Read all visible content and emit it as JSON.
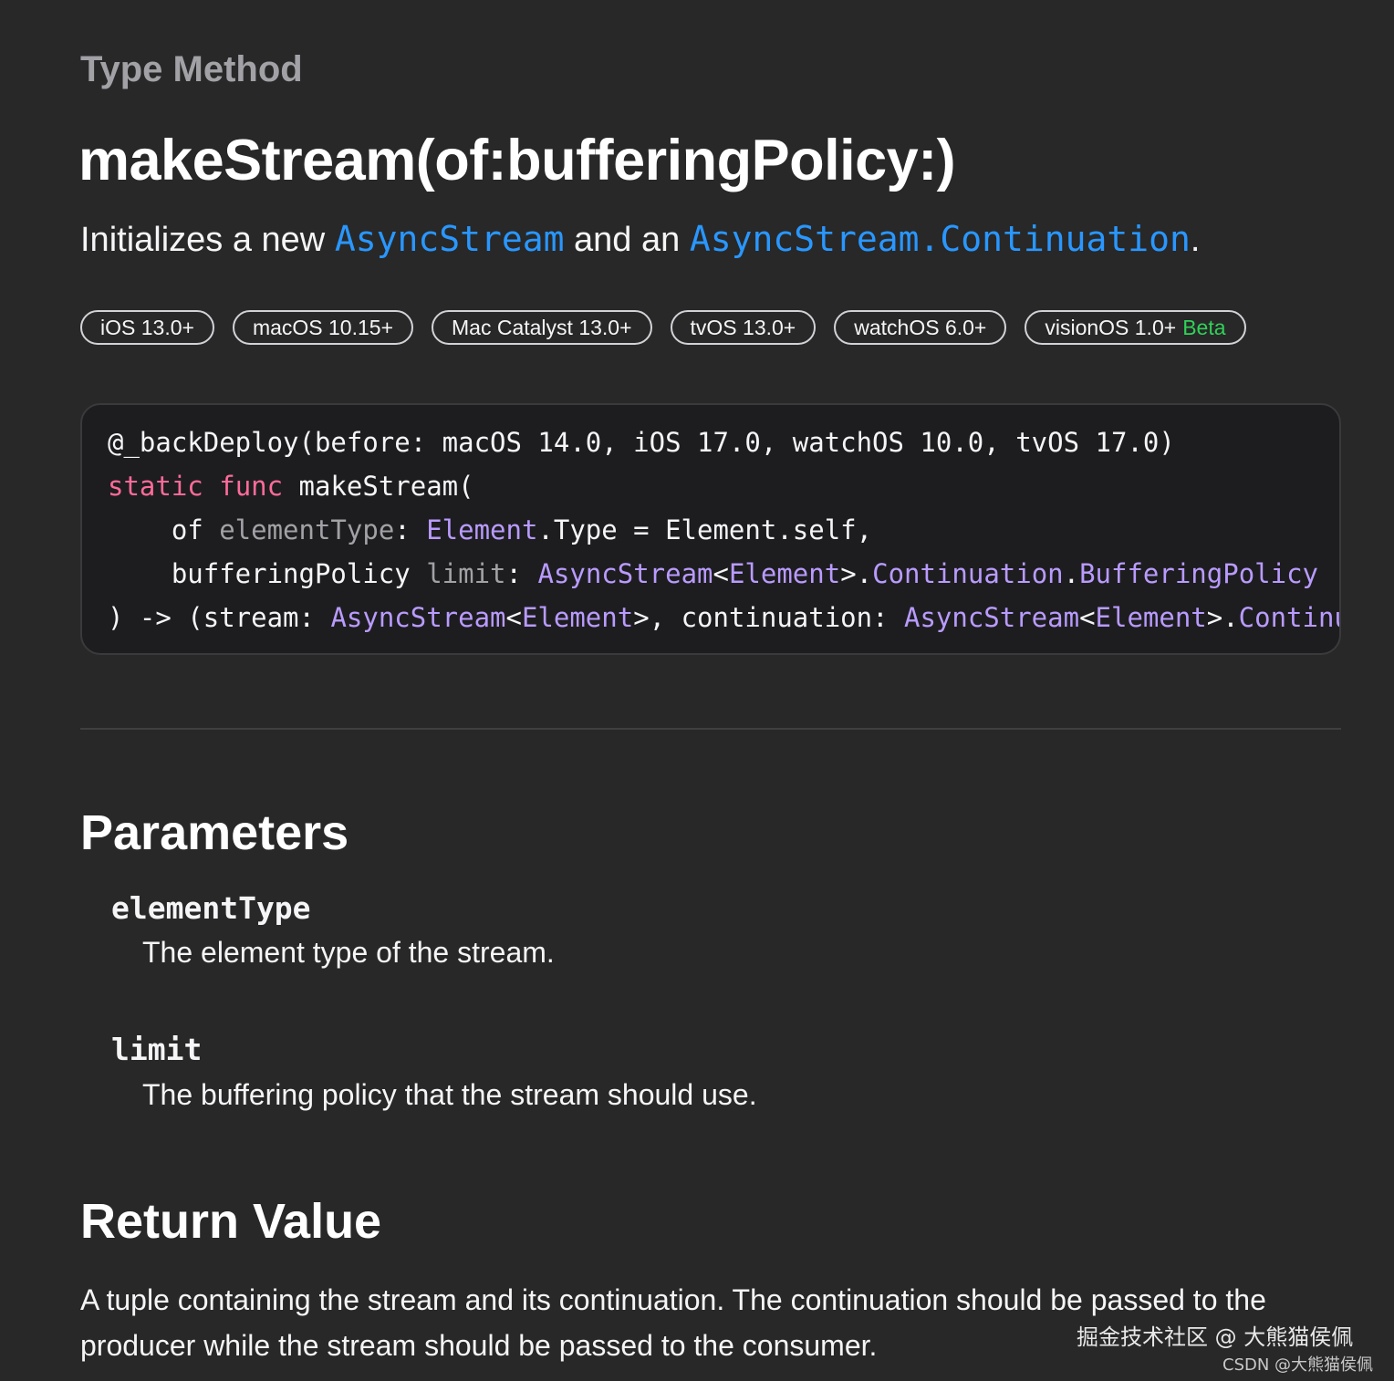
{
  "eyebrow": "Type Method",
  "title": "makeStream(of:bufferingPolicy:)",
  "abstract": {
    "prefix": "Initializes a new ",
    "link1": "AsyncStream",
    "middle": " and an ",
    "link2": "AsyncStream.Continuation",
    "suffix": "."
  },
  "platforms": [
    {
      "label": "iOS 13.0+"
    },
    {
      "label": "macOS 10.15+"
    },
    {
      "label": "Mac Catalyst 13.0+"
    },
    {
      "label": "tvOS 13.0+"
    },
    {
      "label": "watchOS 6.0+"
    },
    {
      "label": "visionOS 1.0+",
      "beta": "Beta"
    }
  ],
  "declaration": {
    "line1": "@_backDeploy(before: macOS 14.0, iOS 17.0, watchOS 10.0, tvOS 17.0)",
    "line2_kw1": "static",
    "line2_kw2": "func",
    "line2_rest": " makeStream(",
    "line3_label": "    of ",
    "line3_param": "elementType",
    "line3_colon": ": ",
    "line3_type": "Element",
    "line3_rest": ".Type = Element.self,",
    "line4_label": "    bufferingPolicy ",
    "line4_param": "limit",
    "line4_colon": ": ",
    "line4_type1": "AsyncStream",
    "line4_lt": "<",
    "line4_type2": "Element",
    "line4_gt": ">.",
    "line4_type3": "Continuation",
    "line4_dot": ".",
    "line4_type4": "BufferingPolicy",
    "line5_start": ") -> (stream: ",
    "line5_type1": "AsyncStream",
    "line5_lt": "<",
    "line5_type2": "Element",
    "line5_mid": ">, continuation: ",
    "line5_type3": "AsyncStream",
    "line5_lt2": "<",
    "line5_type4": "Element",
    "line5_gt2": ">.",
    "line5_type5": "Continuation"
  },
  "parameters": {
    "heading": "Parameters",
    "items": [
      {
        "name": "elementType",
        "description": "The element type of the stream."
      },
      {
        "name": "limit",
        "description": "The buffering policy that the stream should use."
      }
    ]
  },
  "return_value": {
    "heading": "Return Value",
    "text": "A tuple containing the stream and its continuation. The continuation should be passed to the producer while the stream should be passed to the consumer."
  },
  "watermark": {
    "main": "掘金技术社区 @ 大熊猫侯佩",
    "sub": "CSDN @大熊猫侯佩"
  },
  "colors": {
    "background": "#282828",
    "link": "#2997ff",
    "keyword": "#ff6b9a",
    "type": "#b99bff",
    "beta": "#30d158"
  }
}
